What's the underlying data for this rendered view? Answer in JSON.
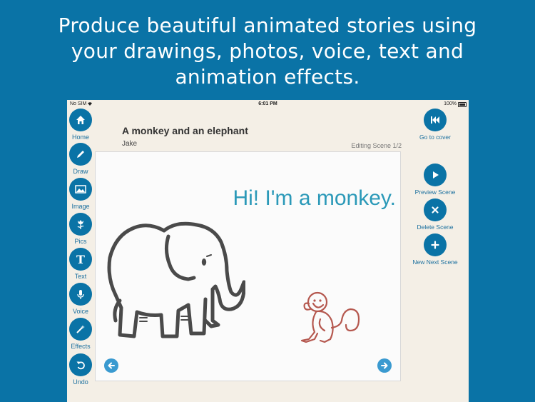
{
  "headline": {
    "line1": "Produce beautiful animated stories using",
    "line2": "your drawings, photos, voice, text and",
    "line3": "animation effects."
  },
  "status_bar": {
    "carrier": "No SIM",
    "time": "6:01 PM",
    "battery": "100%"
  },
  "left_toolbar": {
    "home": "Home",
    "draw": "Draw",
    "image": "Image",
    "pics": "Pics",
    "text": "Text",
    "voice": "Voice",
    "effects": "Effects",
    "undo": "Undo"
  },
  "right_toolbar": {
    "go_to_cover": "Go to cover",
    "preview_scene": "Preview Scene",
    "delete_scene": "Delete Scene",
    "new_next_scene": "New Next Scene"
  },
  "story": {
    "title": "A monkey and an elephant",
    "author": "Jake",
    "editing_status": "Editing Scene 1/2",
    "scene_text": "Hi! I'm a monkey."
  },
  "colors": {
    "background": "#0a73a6",
    "button": "#0a73a6",
    "scene_text": "#2b99b8",
    "monkey_outline": "#b5584f",
    "elephant_outline": "#4a4a4a"
  }
}
